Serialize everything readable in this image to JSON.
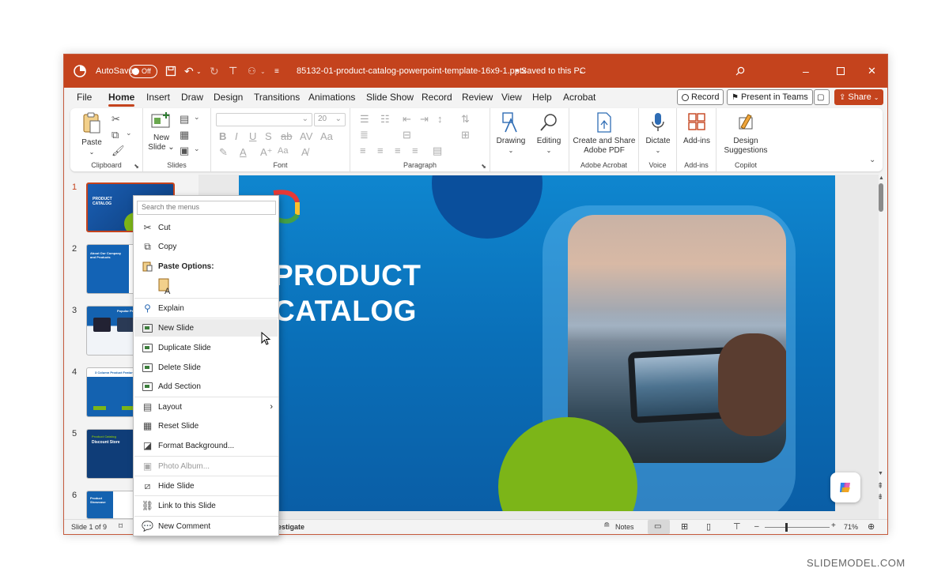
{
  "titlebar": {
    "autosave_label": "AutoSave",
    "autosave_state": "Off",
    "filename": "85132-01-product-catalog-powerpoint-template-16x9-1.pptx",
    "save_status": "• Saved to this PC",
    "accent": "#c4431d"
  },
  "tabs": [
    "File",
    "Home",
    "Insert",
    "Draw",
    "Design",
    "Transitions",
    "Animations",
    "Slide Show",
    "Record",
    "Review",
    "View",
    "Help",
    "Acrobat"
  ],
  "ribbon_buttons": {
    "record": "Record",
    "present_teams": "Present in Teams",
    "share": "Share"
  },
  "ribbon": {
    "paste": "Paste",
    "clipboard": "Clipboard",
    "new_slide_1": "New",
    "new_slide_2": "Slide",
    "slides": "Slides",
    "font_size": "20",
    "font": "Font",
    "paragraph": "Paragraph",
    "drawing": "Drawing",
    "editing": "Editing",
    "create_share_1": "Create and Share",
    "create_share_2": "Adobe PDF",
    "adobe_acrobat": "Adobe Acrobat",
    "dictate": "Dictate",
    "voice": "Voice",
    "addins_btn": "Add-ins",
    "addins_grp": "Add-ins",
    "design_1": "Design",
    "design_2": "Suggestions",
    "copilot": "Copilot"
  },
  "thumbnails": {
    "numbers": [
      "1",
      "2",
      "3",
      "4",
      "5",
      "6"
    ],
    "t1_title_1": "PRODUCT",
    "t1_title_2": "CATALOG",
    "t2_title": "About Our Company and Products",
    "t3_title": "Popular Pr",
    "t4_title": "3 Column Product Features",
    "t5_title_1": "Product Catalog",
    "t5_title_2": "Discount Store",
    "t6_title": "Product Showcase"
  },
  "slide": {
    "title_line1": "PRODUCT",
    "title_line2": "CATALOG"
  },
  "context_menu": {
    "search_placeholder": "Search the menus",
    "cut": "Cut",
    "copy": "Copy",
    "paste_options": "Paste Options:",
    "explain": "Explain",
    "new_slide": "New Slide",
    "duplicate_slide": "Duplicate Slide",
    "delete_slide": "Delete Slide",
    "add_section": "Add Section",
    "layout": "Layout",
    "reset_slide": "Reset Slide",
    "format_background": "Format Background...",
    "photo_album": "Photo Album...",
    "hide_slide": "Hide Slide",
    "link_to_slide": "Link to this Slide",
    "new_comment": "New Comment"
  },
  "statusbar": {
    "slide_count": "Slide 1 of 9",
    "notes_partial": "estigate",
    "notes": "Notes",
    "zoom": "71%"
  },
  "watermark": "SLIDEMODEL.COM"
}
